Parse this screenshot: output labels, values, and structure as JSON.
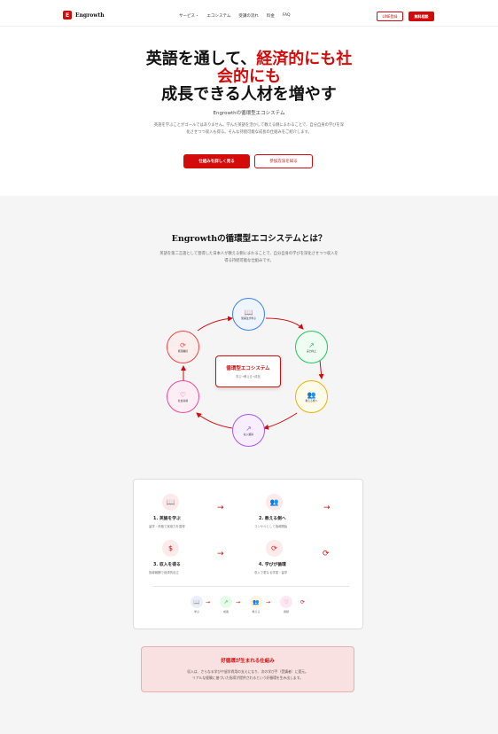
{
  "nav": {
    "brand": "Engrowth",
    "brand_mark": "E",
    "links": [
      "サービス・",
      "エコシステム",
      "受講の流れ",
      "料金",
      "FAQ"
    ],
    "line_btn": "LINE登録",
    "apply_btn": "無料相談"
  },
  "hero": {
    "title_l1a": "英語を通して、",
    "title_l1b": "経済的にも社",
    "title_l2": "会的にも",
    "title_l3": "成長できる人材を増やす",
    "subtitle": "Engrowthの循環型エコシステム",
    "desc": "英語を学ぶことがゴールではありません。学んだ英語を活かして教える側にまわることで、自分自身の学びを深化させつつ収入も得る。そんな持続可能な成長の仕組みをご紹介します。",
    "cta_primary": "仕組みを詳しく見る",
    "cta_secondary": "参加方法を知る"
  },
  "eco": {
    "title": "Engrowthの循環型エコシステムとは？",
    "desc": "英語を第二言語として習得した日本人が教える側にまわることで、自分自身の学びを深化させつつ収入を得る持続可能な仕組みです。",
    "center_title": "循環型エコシステム",
    "center_sub": "学ぶ→教える→成長",
    "nodes": [
      {
        "label": "受講生が学ぶ",
        "icon": "book-icon",
        "color": "#3b82f6"
      },
      {
        "label": "実力向上",
        "icon": "trend-icon",
        "color": "#22c55e"
      },
      {
        "label": "教える側へ",
        "icon": "users-icon",
        "color": "#eab308"
      },
      {
        "label": "収入獲得",
        "icon": "trend-icon",
        "color": "#a855f7"
      },
      {
        "label": "社会貢献",
        "icon": "heart-icon",
        "color": "#ec4899"
      },
      {
        "label": "循環継続",
        "icon": "cycle-icon",
        "color": "#ef4444"
      }
    ]
  },
  "steps": [
    {
      "title": "1. 英語を学ぶ",
      "desc": "留学・資格で実用力を習得",
      "icon": "book-icon"
    },
    {
      "title": "2. 教える側へ",
      "desc": "コンサルとして指導開始",
      "icon": "users-icon"
    },
    {
      "title": "3. 収入を得る",
      "desc": "指導報酬で経済的自立",
      "icon": "dollar-icon"
    },
    {
      "title": "4. 学びが循環",
      "desc": "収入で更なる学習・留学",
      "icon": "cycle-icon"
    }
  ],
  "mini_flow": [
    "学ぶ",
    "成長",
    "教える",
    "貢献"
  ],
  "loop": {
    "title": "好循環が生まれる仕組み",
    "desc_l1": "収入は、さらなる学びや留学費用の支えになり、次の学び手（受講者）に還元。",
    "desc_l2": "リアルな経験に基づいた指導が提供されるという好循環を生み出します。"
  },
  "colors": {
    "accent": "#d40b0b",
    "section_bg": "#f5f5f5"
  }
}
